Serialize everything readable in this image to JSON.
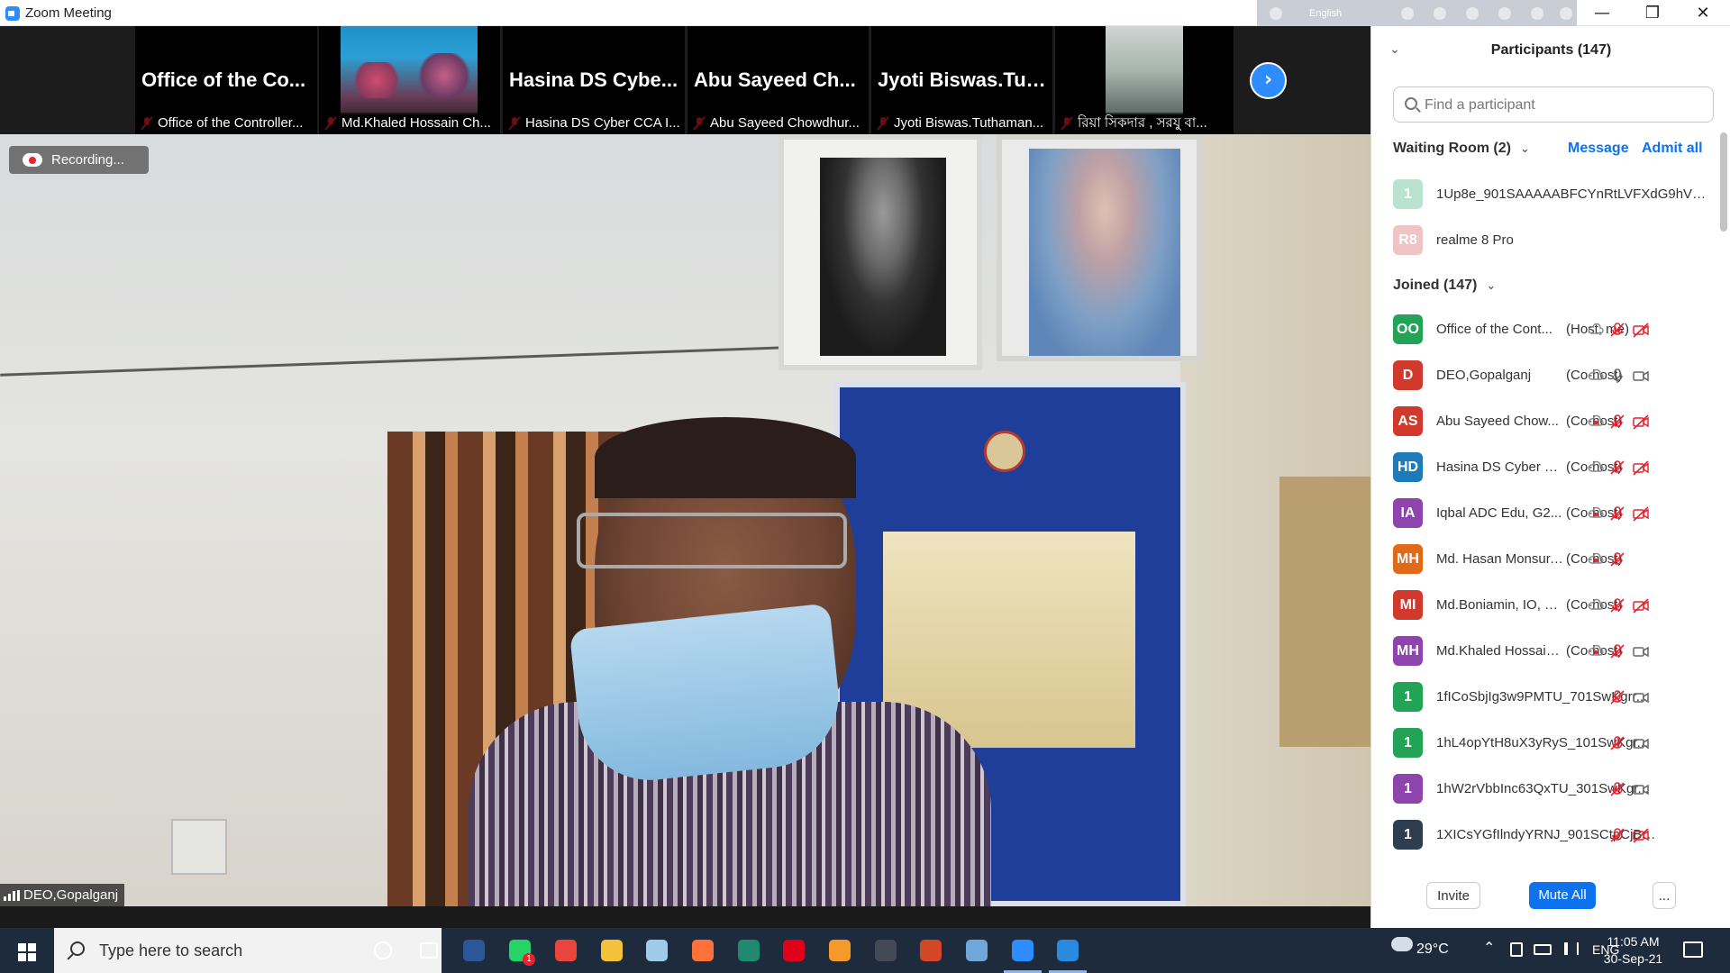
{
  "window": {
    "title": "Zoom Meeting",
    "ime_language": "English"
  },
  "thumbnails": [
    {
      "tile_name": "Office of the Co...",
      "caption": "Office of the Controller...",
      "type": "name"
    },
    {
      "tile_name": "",
      "caption": "Md.Khaled Hossain Ch...",
      "type": "video-reef"
    },
    {
      "tile_name": "Hasina DS Cybe...",
      "caption": "Hasina DS Cyber CCA I...",
      "type": "name"
    },
    {
      "tile_name": "Abu Sayeed Ch...",
      "caption": "Abu Sayeed Chowdhur...",
      "type": "name"
    },
    {
      "tile_name": "Jyoti Biswas.Tut...",
      "caption": "Jyoti Biswas.Tuthaman...",
      "type": "name"
    },
    {
      "tile_name": "",
      "caption": "রিয়া সিকদার , সরযু বা...",
      "type": "video-room"
    }
  ],
  "main_video": {
    "recording_label": "Recording...",
    "speaker_name": "DEO,Gopalganj"
  },
  "participants": {
    "title": "Participants (147)",
    "search_placeholder": "Find a participant",
    "waiting_room": {
      "label": "Waiting Room (2)",
      "message_link": "Message",
      "admit_all_link": "Admit all",
      "people": [
        {
          "avatar": "1",
          "color": "#b9e2cf",
          "name": "1Up8e_901SAAAAABFCYnRtLVFXdG9hV3..."
        },
        {
          "avatar": "R8",
          "color": "#efc4c4",
          "name": "realme 8 Pro"
        }
      ]
    },
    "joined": {
      "label": "Joined (147)",
      "people": [
        {
          "avatar": "OO",
          "color": "#23a356",
          "name": "Office of the Cont...",
          "role": "(Host, me)",
          "cloud": "cloud-icon",
          "mic": "muted",
          "video": "off"
        },
        {
          "avatar": "D",
          "color": "#d0392b",
          "name": "DEO,Gopalganj",
          "role": "(Co-host)",
          "cloud": "cloud-icon",
          "mic": "on",
          "video": "on"
        },
        {
          "avatar": "AS",
          "color": "#d0392b",
          "name": "Abu Sayeed Chow...",
          "role": "(Co-host)",
          "cloud": "cloud-record-icon",
          "mic": "muted",
          "video": "off"
        },
        {
          "avatar": "HD",
          "color": "#1f7bb8",
          "name": "Hasina DS Cyber C...",
          "role": "(Co-host)",
          "cloud": "cloud-icon",
          "mic": "muted",
          "video": "off"
        },
        {
          "avatar": "IA",
          "color": "#8e44ad",
          "name": "Iqbal ADC Edu, G2...",
          "role": "(Co-host)",
          "cloud": "cloud-record-icon",
          "mic": "muted",
          "video": "off"
        },
        {
          "avatar": "MH",
          "color": "#e06a17",
          "name": "Md. Hasan Monsur, AP ...",
          "role": "(Co-host)",
          "cloud": "cloud-record-icon",
          "mic": "muted",
          "video": "none"
        },
        {
          "avatar": "MI",
          "color": "#d0392b",
          "name": "Md.Boniamin, IO, C...",
          "role": "(Co-host)",
          "cloud": "cloud-icon",
          "mic": "muted",
          "video": "off"
        },
        {
          "avatar": "MH",
          "color": "#8e44ad",
          "name": "Md.Khaled Hossain...",
          "role": "(Co-host)",
          "cloud": "cloud-record-icon",
          "mic": "muted",
          "video": "on"
        },
        {
          "avatar": "1",
          "color": "#23a356",
          "name": "1fICoSbjIg3w9PMTU_701SwKgrr...",
          "role": "",
          "cloud": "",
          "mic": "muted",
          "video": "on"
        },
        {
          "avatar": "1",
          "color": "#23a356",
          "name": "1hL4opYtH8uX3yRyS_101SwKgr...",
          "role": "",
          "cloud": "",
          "mic": "muted",
          "video": "on"
        },
        {
          "avatar": "1",
          "color": "#8e44ad",
          "name": "1hW2rVbbInc63QxTU_301SwKgr...",
          "role": "",
          "cloud": "",
          "mic": "muted",
          "video": "on"
        },
        {
          "avatar": "1",
          "color": "#2c3e50",
          "name": "1XICsYGfIlndyYRNJ_901SCtpCjBF...",
          "role": "",
          "cloud": "",
          "mic": "muted",
          "video": "off"
        }
      ]
    },
    "footer": {
      "invite": "Invite",
      "mute_all": "Mute All",
      "more": "..."
    }
  },
  "taskbar": {
    "search_placeholder": "Type here to search",
    "apps": [
      {
        "name": "cortana-icon",
        "color": "#1e2b3d"
      },
      {
        "name": "task-view-icon",
        "color": "#1e2b3d"
      },
      {
        "name": "word-icon",
        "color": "#2b5797"
      },
      {
        "name": "whatsapp-icon",
        "color": "#25d366",
        "badge": "1"
      },
      {
        "name": "chrome-icon",
        "color": "#e8453c"
      },
      {
        "name": "file-explorer-icon",
        "color": "#f3c13a"
      },
      {
        "name": "notepad-icon",
        "color": "#9ecbe8"
      },
      {
        "name": "firefox-icon",
        "color": "#ff7139"
      },
      {
        "name": "download-app-icon",
        "color": "#1f8a70"
      },
      {
        "name": "opera-icon",
        "color": "#e1001a"
      },
      {
        "name": "app-orange-icon",
        "color": "#f39a2b"
      },
      {
        "name": "obs-icon",
        "color": "#444a55"
      },
      {
        "name": "powerpoint-icon",
        "color": "#d24726"
      },
      {
        "name": "paint-icon",
        "color": "#6fa7d8"
      },
      {
        "name": "zoom-icon",
        "color": "#2d8cff"
      },
      {
        "name": "media-player-icon",
        "color": "#2a8ae0"
      }
    ],
    "weather": "29°C",
    "language": "ENG",
    "time": "11:05 AM",
    "date": "30-Sep-21"
  }
}
